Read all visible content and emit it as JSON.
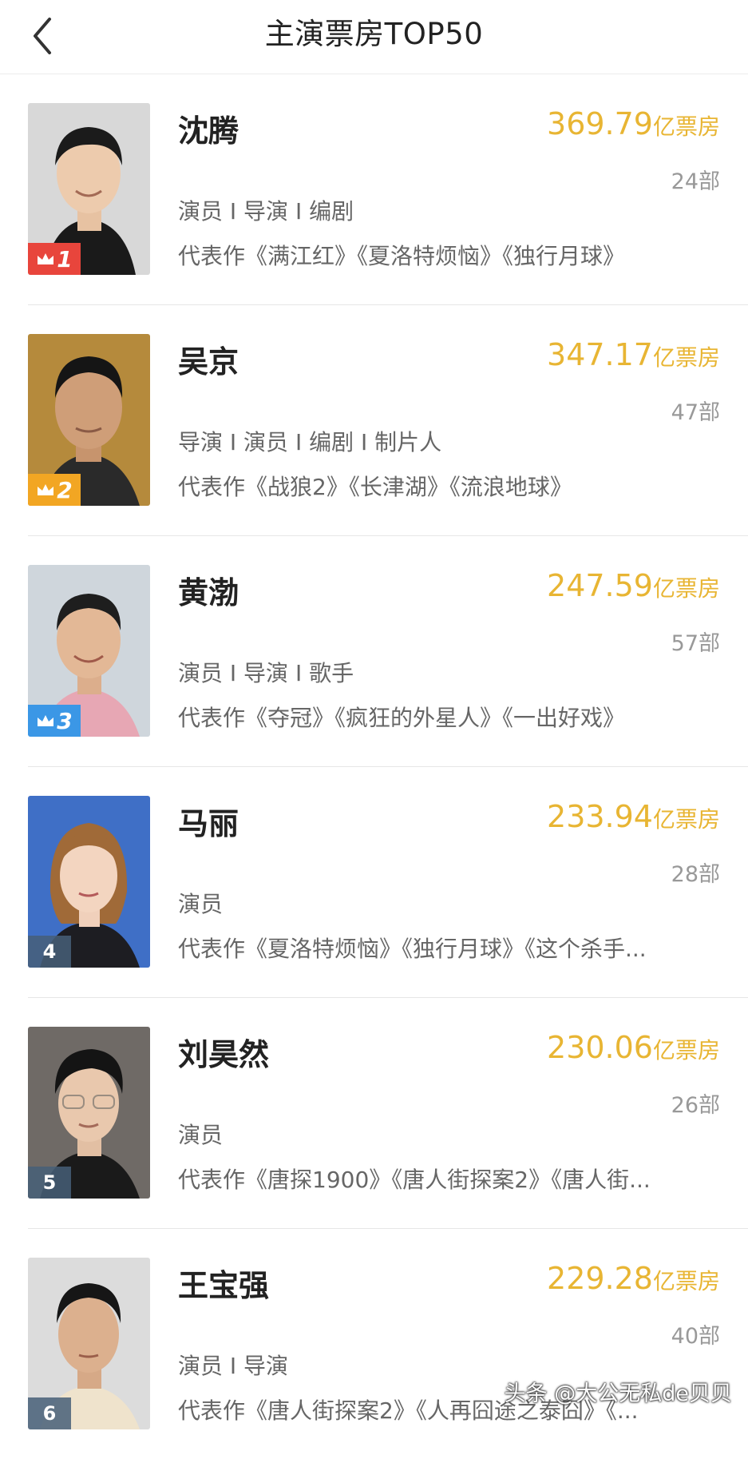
{
  "header": {
    "back_icon": "chevron-left-icon",
    "title": "主演票房TOP50"
  },
  "colors": {
    "accent": "#e8b533",
    "rank1": "#e8453c",
    "rank2": "#f2a623",
    "rank3": "#3b97e6",
    "rank_default": "#465f78"
  },
  "actors": [
    {
      "rank": "1",
      "name": "沈腾",
      "box_office": "369.79",
      "box_office_unit": "亿票房",
      "film_count": "24部",
      "roles": "演员 I 导演 I 编剧",
      "works": "代表作《满江红》《夏洛特烦恼》《独行月球》"
    },
    {
      "rank": "2",
      "name": "吴京",
      "box_office": "347.17",
      "box_office_unit": "亿票房",
      "film_count": "47部",
      "roles": "导演 I 演员 I 编剧 I 制片人",
      "works": "代表作《战狼2》《长津湖》《流浪地球》"
    },
    {
      "rank": "3",
      "name": "黄渤",
      "box_office": "247.59",
      "box_office_unit": "亿票房",
      "film_count": "57部",
      "roles": "演员 I 导演 I 歌手",
      "works": "代表作《夺冠》《疯狂的外星人》《一出好戏》"
    },
    {
      "rank": "4",
      "name": "马丽",
      "box_office": "233.94",
      "box_office_unit": "亿票房",
      "film_count": "28部",
      "roles": "演员",
      "works": "代表作《夏洛特烦恼》《独行月球》《这个杀手..."
    },
    {
      "rank": "5",
      "name": "刘昊然",
      "box_office": "230.06",
      "box_office_unit": "亿票房",
      "film_count": "26部",
      "roles": "演员",
      "works": "代表作《唐探1900》《唐人街探案2》《唐人街..."
    },
    {
      "rank": "6",
      "name": "王宝强",
      "box_office": "229.28",
      "box_office_unit": "亿票房",
      "film_count": "40部",
      "roles": "演员 I 导演",
      "works": "代表作《唐人街探案2》《人再囧途之泰囧》《..."
    }
  ],
  "watermark": "头条 @大公无私de贝贝"
}
